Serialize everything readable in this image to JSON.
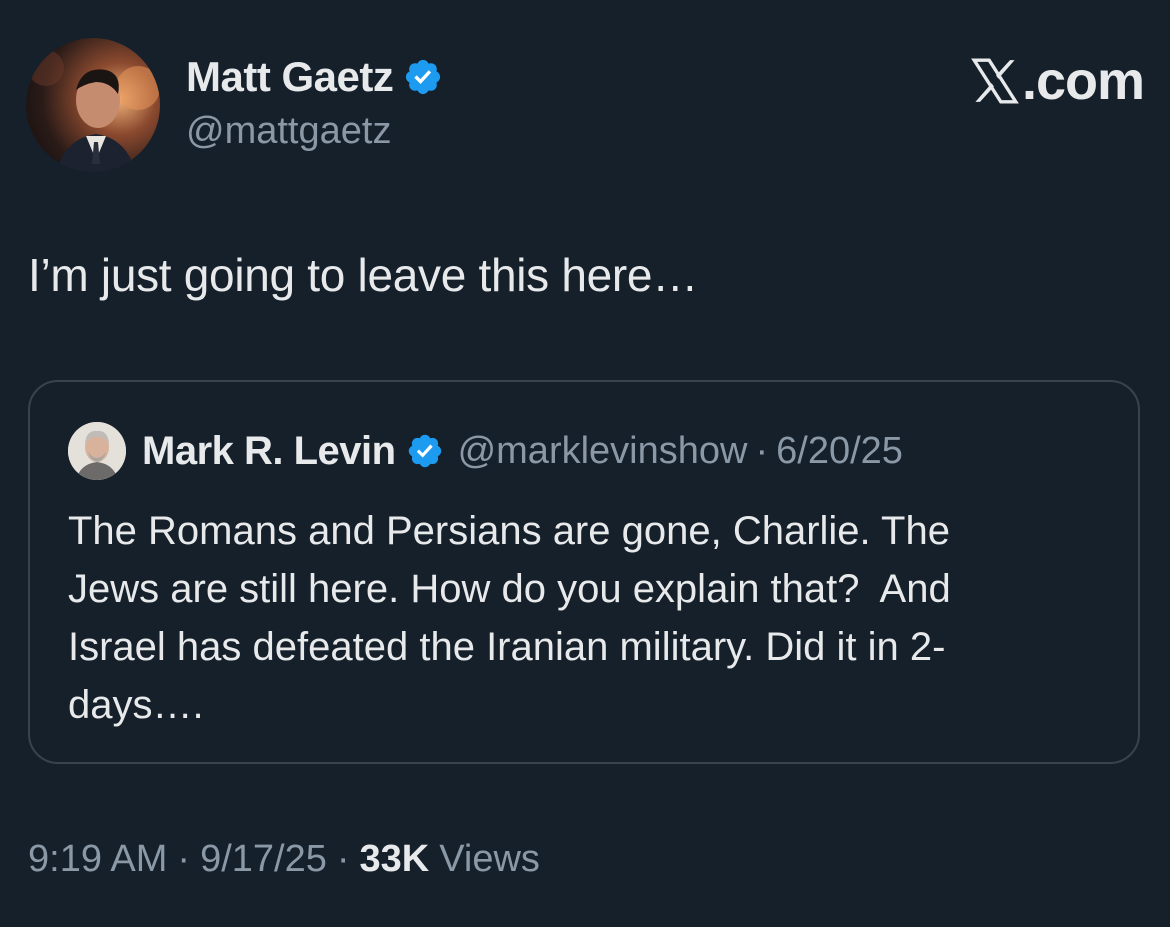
{
  "post": {
    "author": {
      "display_name": "Matt Gaetz",
      "handle": "@mattgaetz",
      "verified": true
    },
    "brand": ".com",
    "text": "I’m just going to leave this here…",
    "quoted": {
      "author": {
        "display_name": "Mark R. Levin",
        "handle": "@marklevinshow",
        "verified": true
      },
      "separator": "·",
      "date": "6/20/25",
      "text": "The Romans and Persians are gone, Charlie. The\nJews are still here. How do you explain that?  And\nIsrael has defeated the Iranian military. Did it in 2-\ndays…."
    },
    "meta": {
      "time": "9:19 AM",
      "date": "9/17/25",
      "separator": "·",
      "views_count": "33K",
      "views_label": "Views"
    }
  },
  "icons": {
    "verified": "verified-badge-icon",
    "brand": "x-logo-icon"
  },
  "colors": {
    "background": "#15202b",
    "primary_text": "#e7e9ea",
    "secondary_text": "#8b98a5",
    "verified_blue": "#1d9bf0",
    "border": "#38444d"
  }
}
